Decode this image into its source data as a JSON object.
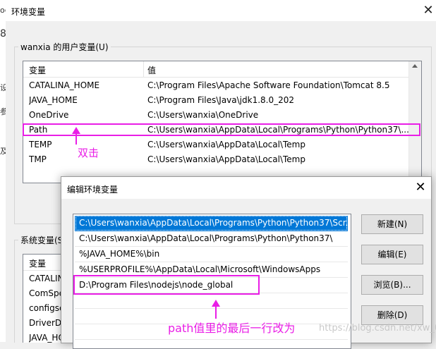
{
  "outer_dialog": {
    "title": "环境变量",
    "close_glyph": "✕",
    "user_vars": {
      "group_label": "wanxia 的用户变量(U)",
      "columns": [
        "变量",
        "值"
      ],
      "rows": [
        {
          "name": "CATALINA_HOME",
          "value": "C:\\Program Files\\Apache Software Foundation\\Tomcat 8.5"
        },
        {
          "name": "JAVA_HOME",
          "value": "C:\\Program Files\\Java\\jdk1.8.0_202"
        },
        {
          "name": "OneDrive",
          "value": "C:\\Users\\wanxia\\OneDrive"
        },
        {
          "name": "Path",
          "value": "C:\\Users\\wanxia\\AppData\\Local\\Programs\\Python\\Python37\\..."
        },
        {
          "name": "TEMP",
          "value": "C:\\Users\\wanxia\\AppData\\Local\\Temp"
        },
        {
          "name": "TMP",
          "value": "C:\\Users\\wanxia\\AppData\\Local\\Temp"
        }
      ]
    },
    "system_vars": {
      "group_label": "系统变量(S",
      "columns": [
        "变量"
      ],
      "rows": [
        "CATALINA",
        "ComSpe",
        "configse",
        "DriverD",
        "JAVA_HO"
      ]
    }
  },
  "background_window": {
    "fragments": [
      "oc",
      "8",
      "设",
      "参",
      "及"
    ]
  },
  "edit_dialog": {
    "title": "编辑环境变量",
    "close_glyph": "✕",
    "paths": [
      "C:\\Users\\wanxia\\AppData\\Local\\Programs\\Python\\Python37\\Scr...",
      "C:\\Users\\wanxia\\AppData\\Local\\Programs\\Python\\Python37\\",
      "%JAVA_HOME%\\bin",
      "%USERPROFILE%\\AppData\\Local\\Microsoft\\WindowsApps",
      "D:\\Program Files\\nodejs\\node_global"
    ],
    "selected_index": 0,
    "buttons": {
      "new": "新建(N)",
      "edit": "编辑(E)",
      "browse": "浏览(B)...",
      "delete": "删除(D)"
    }
  },
  "annotations": {
    "double_click": "双击",
    "path_note": "path值里的最后一行改为",
    "color": "#e91ee6"
  },
  "watermark": "https://blog.csdn.net/xw_009"
}
